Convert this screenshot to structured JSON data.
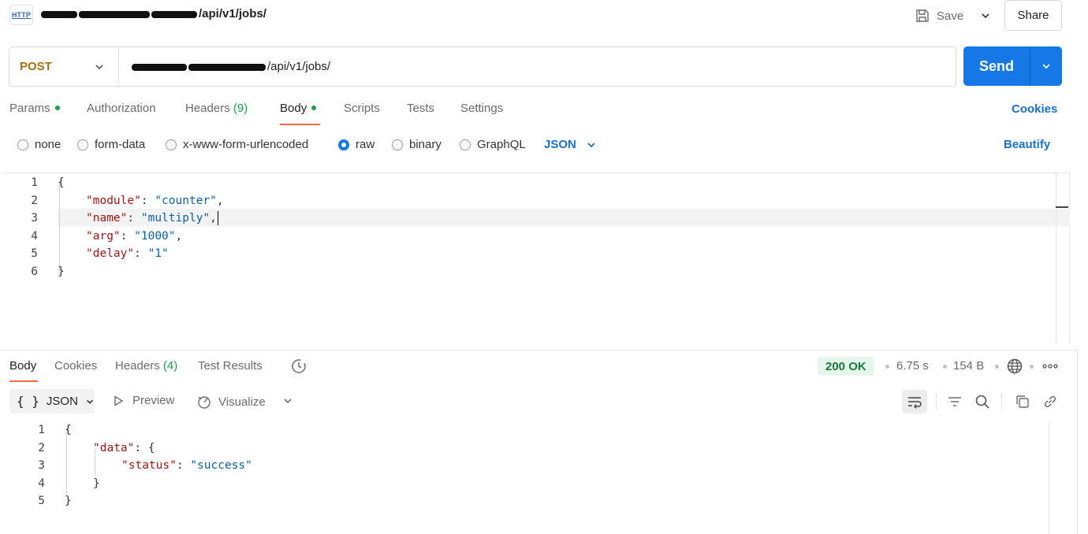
{
  "request": {
    "title_suffix": "/api/v1/jobs/",
    "save_label": "Save",
    "share_label": "Share",
    "method": "POST",
    "url_suffix": "/api/v1/jobs/",
    "send_label": "Send"
  },
  "request_tabs": [
    {
      "label": "Params",
      "dot": true
    },
    {
      "label": "Authorization"
    },
    {
      "label": "Headers",
      "count": "(9)"
    },
    {
      "label": "Body",
      "dot": true,
      "active": true
    },
    {
      "label": "Scripts"
    },
    {
      "label": "Tests"
    },
    {
      "label": "Settings"
    }
  ],
  "cookies_label": "Cookies",
  "body_types": [
    {
      "label": "none"
    },
    {
      "label": "form-data"
    },
    {
      "label": "x-www-form-urlencoded"
    },
    {
      "label": "raw",
      "selected": true
    },
    {
      "label": "binary"
    },
    {
      "label": "GraphQL"
    }
  ],
  "language": "JSON",
  "beautify_label": "Beautify",
  "request_body": {
    "line_numbers": [
      "1",
      "2",
      "3",
      "4",
      "5",
      "6"
    ],
    "open_brace": "{",
    "close_brace": "}",
    "fields": [
      {
        "key": "\"module\"",
        "value": "\"counter\"",
        "trail": ","
      },
      {
        "key": "\"name\"",
        "value": "\"multiply\"",
        "trail": ","
      },
      {
        "key": "\"arg\"",
        "value": "\"1000\"",
        "trail": ","
      },
      {
        "key": "\"delay\"",
        "value": "\"1\"",
        "trail": ""
      }
    ]
  },
  "response_tabs": [
    {
      "label": "Body",
      "active": true
    },
    {
      "label": "Cookies"
    },
    {
      "label": "Headers",
      "count": "(4)"
    },
    {
      "label": "Test Results"
    }
  ],
  "response_meta": {
    "status": "200 OK",
    "time": "6.75 s",
    "size": "154 B"
  },
  "response_toolbar": {
    "format": "JSON",
    "format_icon": "{ }",
    "preview_label": "Preview",
    "visualize_label": "Visualize"
  },
  "response_body": {
    "line_numbers": [
      "1",
      "2",
      "3",
      "4",
      "5"
    ],
    "l1": "{",
    "l2_key": "\"data\"",
    "l2_rest": ": {",
    "l3_key": "\"status\"",
    "l3_sep": ": ",
    "l3_value": "\"success\"",
    "l4": "}",
    "l5": "}"
  },
  "colors": {
    "accent": "#1478e6",
    "method": "#a86f0f",
    "tab_underline": "#f26b3a",
    "status_ok": "#157a3c",
    "dot_green": "#1aa053"
  },
  "icons": [
    "http-icon",
    "save-icon",
    "chevron-down-icon",
    "history-icon",
    "globe-icon",
    "more-icon",
    "play-icon",
    "visualize-icon",
    "wrap-icon",
    "filter-icon",
    "search-icon",
    "copy-icon",
    "link-icon"
  ]
}
